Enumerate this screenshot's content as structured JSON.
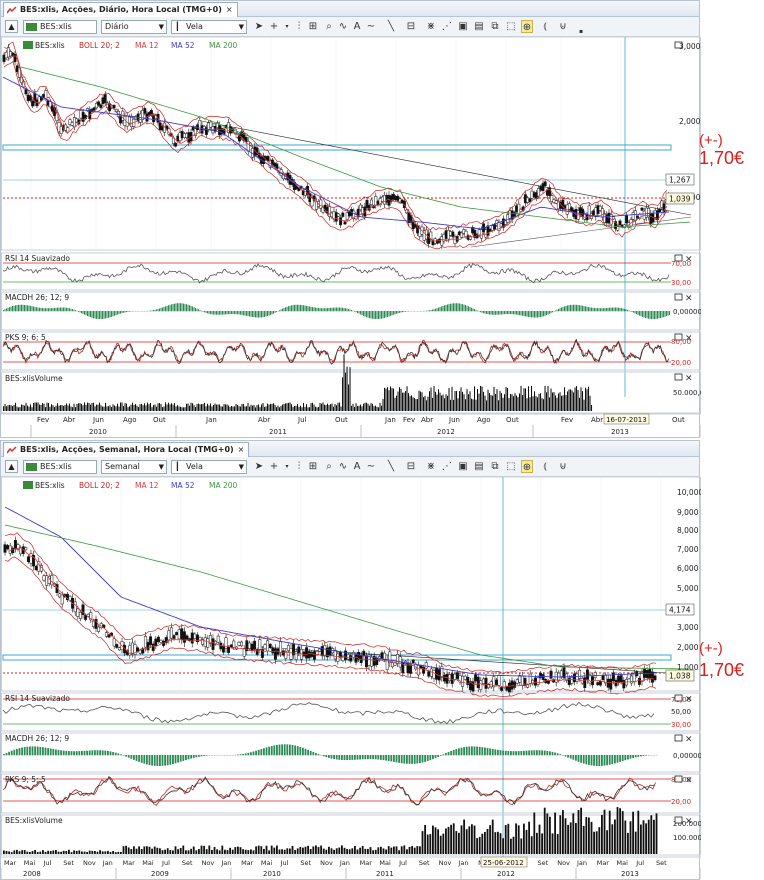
{
  "colors": {
    "accent_red": "#d9201c",
    "boll": "#c8241f",
    "ma12": "#d93a3a",
    "ma52": "#3c3cd0",
    "ma200": "#3c9a3c",
    "macd": "#2e8b57",
    "cyan": "#3aa7d8",
    "volume": "#111111"
  },
  "top": {
    "tab_title": "BES:xlis, Acções, Diário, Hora Local (TMG+0)",
    "symbol": "BES:xlis",
    "period": "Diário",
    "chart_type": "Vela",
    "legend": {
      "symbol": "BES:xlis",
      "boll": "BOLL 20; 2",
      "ma12": "MA 12",
      "ma52": "MA 52",
      "ma200": "MA 200"
    },
    "price_ticks": [
      "3,000",
      "2,000",
      "1,000"
    ],
    "price_badges": [
      "1,267",
      "1,039"
    ],
    "annotation_pm": "(+-)",
    "annotation_price": "1,70€",
    "rsi": {
      "label": "RSI 14 Suavizado",
      "levels": [
        "70,00",
        "30,00"
      ]
    },
    "macd": {
      "label": "MACDH 26; 12; 9",
      "level": "0,00000"
    },
    "pks": {
      "label": "PKS 9; 6; 5",
      "levels": [
        "80,00",
        "20,00"
      ]
    },
    "volume": {
      "label": "BES:xlisVolume",
      "level": "50.000,0"
    },
    "months": [
      "Fev",
      "Abr",
      "Jun",
      "Ago",
      "Out",
      "Jan",
      "Abr",
      "Jul",
      "Out",
      "Jan",
      "Fev",
      "Abr",
      "Jun",
      "Ago",
      "Out",
      "Fev",
      "Abr",
      "Jun",
      "Out"
    ],
    "years": [
      "2010",
      "2011",
      "2012",
      "2013"
    ],
    "cursor_date": "16-07-2013"
  },
  "bottom": {
    "tab_title": "BES:xlis, Acções, Semanal, Hora Local (TMG+0)",
    "symbol": "BES:xlis",
    "period": "Semanal",
    "chart_type": "Vela",
    "legend": {
      "symbol": "BES:xlis",
      "boll": "BOLL 20; 2",
      "ma12": "MA 12",
      "ma52": "MA 52",
      "ma200": "MA 200"
    },
    "price_ticks": [
      "10,000",
      "9,000",
      "8,000",
      "7,000",
      "6,000",
      "5,000",
      "3,000",
      "2,000",
      "1,000"
    ],
    "price_badges": [
      "4,174",
      "1,038"
    ],
    "annotation_pm": "(+-)",
    "annotation_price": "1,70€",
    "rsi": {
      "label": "RSI 14 Suavizado",
      "levels": [
        "70,00",
        "50,00",
        "30,00"
      ]
    },
    "macd": {
      "label": "MACDH 26; 12; 9",
      "level": "0,00000"
    },
    "pks": {
      "label": "PKS 9; 5; 5",
      "levels": [
        "80,00",
        "20,00"
      ]
    },
    "volume": {
      "label": "BES:xlisVolume",
      "levels": [
        "200.000,0",
        "100.000,0"
      ]
    },
    "months": [
      "Mar",
      "Mai",
      "Jul",
      "Set",
      "Nov",
      "Jan",
      "Mar",
      "Mai",
      "Jul",
      "Set",
      "Nov",
      "Jan",
      "Mar",
      "Mai",
      "Jul",
      "Set",
      "Nov",
      "Jan",
      "Mar",
      "Mai",
      "Jul",
      "Set",
      "Nov",
      "Jan",
      "Mar",
      "Mai",
      "Jul",
      "Set",
      "Nov",
      "Jan",
      "Mar",
      "Mai",
      "Jul",
      "Set"
    ],
    "years": [
      "2008",
      "2009",
      "2010",
      "2011",
      "2012",
      "2013"
    ],
    "cursor_date": "25-06-2012"
  }
}
